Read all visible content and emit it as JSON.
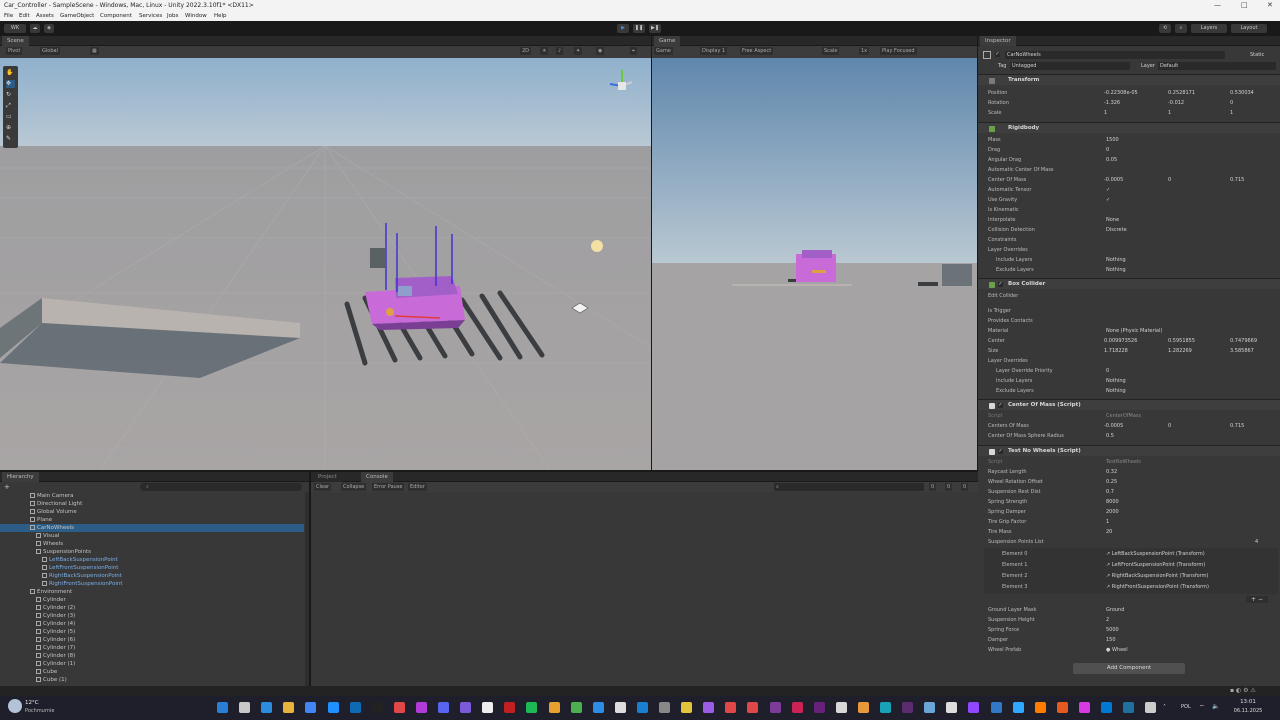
{
  "window": {
    "title": "Car_Controller - SampleScene - Windows, Mac, Linux - Unity 2022.3.10f1* <DX11>",
    "controls": [
      "—",
      "□",
      "✕"
    ]
  },
  "menu": [
    "File",
    "Edit",
    "Assets",
    "GameObject",
    "Component",
    "Services",
    "Jobs",
    "Window",
    "Help"
  ],
  "toolbar": {
    "account": "WK",
    "layers": "Layers",
    "layout": "Layout"
  },
  "scene": {
    "tab": "Scene",
    "pivot": "Pivot",
    "global": "Global",
    "mode_2d": "2D",
    "persp": "Persp"
  },
  "game": {
    "tab": "Game",
    "display_tab": "Game",
    "display": "Display 1",
    "aspect": "Free Aspect",
    "scale_label": "Scale",
    "scale": "1x",
    "play_focused": "Play Focused"
  },
  "inspector": {
    "tab": "Inspector",
    "object_name": "CarNoWheels",
    "static": "Static",
    "tag_label": "Tag",
    "tag": "Untagged",
    "layer_label": "Layer",
    "layer": "Default",
    "transform": {
      "name": "Transform",
      "position_label": "Position",
      "position": [
        "-0.22308e-05",
        "0.2528171",
        "0.530034"
      ],
      "rotation_label": "Rotation",
      "rotation": [
        "-1.326",
        "-0.012",
        "0"
      ],
      "scale_label": "Scale",
      "scale": [
        "1",
        "1",
        "1"
      ]
    },
    "rigidbody": {
      "name": "Rigidbody",
      "rows": [
        [
          "Mass",
          "1500"
        ],
        [
          "Drag",
          "0"
        ],
        [
          "Angular Drag",
          "0.05"
        ],
        [
          "Automatic Center Of Mass",
          ""
        ],
        [
          "Center Of Mass",
          ""
        ],
        [
          "Automatic Tensor",
          "✓"
        ],
        [
          "Use Gravity",
          "✓"
        ],
        [
          "Is Kinematic",
          ""
        ],
        [
          "Interpolate",
          "None"
        ],
        [
          "Collision Detection",
          "Discrete"
        ],
        [
          "Constraints",
          ""
        ],
        [
          "Layer Overrides",
          ""
        ],
        [
          "Include Layers",
          "Nothing"
        ],
        [
          "Exclude Layers",
          "Nothing"
        ]
      ],
      "com": [
        "-0.0005",
        "0",
        "0.715"
      ]
    },
    "box_collider": {
      "name": "Box Collider",
      "rows": [
        [
          "Edit Collider",
          ""
        ],
        [
          "Is Trigger",
          ""
        ],
        [
          "Provides Contacts",
          ""
        ],
        [
          "Material",
          "None (Physic Material)"
        ],
        [
          "Center",
          ""
        ],
        [
          "Size",
          ""
        ],
        [
          "Layer Overrides",
          ""
        ],
        [
          "Layer Override Priority",
          "0"
        ],
        [
          "Include Layers",
          "Nothing"
        ],
        [
          "Exclude Layers",
          "Nothing"
        ]
      ],
      "center": [
        "0.009973526",
        "0.5951855",
        "0.7479669"
      ],
      "size": [
        "1.718228",
        "1.282269",
        "3.585867"
      ]
    },
    "center_of_mass": {
      "name": "Center Of Mass (Script)",
      "script_label": "Script",
      "script": "CenterOfMass",
      "rows": [
        [
          "Centers Of Mass",
          ""
        ],
        [
          "Center Of Mass Sphere Radius",
          "0.5"
        ]
      ],
      "com": [
        "-0.0005",
        "0",
        "0.715"
      ]
    },
    "test_no_wheels": {
      "name": "Test No Wheels (Script)",
      "script_label": "Script",
      "script": "TestNoWheels",
      "rows": [
        [
          "Raycast Length",
          "0.32"
        ],
        [
          "Wheel Rotation Offset",
          "0.25"
        ],
        [
          "Suspension Rest Dist",
          "0.7"
        ],
        [
          "Spring Strength",
          "8000"
        ],
        [
          "Spring Damper",
          "2000"
        ],
        [
          "Tire Grip Factor",
          "1"
        ],
        [
          "Tire Mass",
          "20"
        ]
      ],
      "list_label": "Suspension Points List",
      "list_count": "4",
      "elements": [
        [
          "Element 0",
          "↗ LeftBackSuspensionPoint (Transform)"
        ],
        [
          "Element 1",
          "↗ LeftFrontSuspensionPoint (Transform)"
        ],
        [
          "Element 2",
          "↗ RightBackSuspensionPoint (Transform)"
        ],
        [
          "Element 3",
          "↗ RightFrontSuspensionPoint (Transform)"
        ]
      ],
      "rows2": [
        [
          "Ground Layer Mask",
          "Ground"
        ],
        [
          "Suspension Height",
          "2"
        ],
        [
          "Spring Force",
          "5000"
        ],
        [
          "Damper",
          "150"
        ],
        [
          "Wheel Prefab",
          "● Wheel"
        ]
      ]
    },
    "add_component": "Add Component"
  },
  "hierarchy": {
    "tab": "Hierarchy",
    "items": [
      {
        "label": "Main Camera",
        "indent": 0
      },
      {
        "label": "Directional Light",
        "indent": 0
      },
      {
        "label": "Global Volume",
        "indent": 0
      },
      {
        "label": "Plane",
        "indent": 0
      },
      {
        "label": "CarNoWheels",
        "indent": 0,
        "sel": true
      },
      {
        "label": "Visual",
        "indent": 1
      },
      {
        "label": "Wheels",
        "indent": 1
      },
      {
        "label": "SuspensionPoints",
        "indent": 1
      },
      {
        "label": "LeftBackSuspensionPoint",
        "indent": 2
      },
      {
        "label": "LeftFrontSuspensionPoint",
        "indent": 2
      },
      {
        "label": "RightBackSuspensionPoint",
        "indent": 2
      },
      {
        "label": "RightFrontSuspensionPoint",
        "indent": 2
      },
      {
        "label": "Environment",
        "indent": 0
      },
      {
        "label": "Cylinder",
        "indent": 1
      },
      {
        "label": "Cylinder (2)",
        "indent": 1
      },
      {
        "label": "Cylinder (3)",
        "indent": 1
      },
      {
        "label": "Cylinder (4)",
        "indent": 1
      },
      {
        "label": "Cylinder (5)",
        "indent": 1
      },
      {
        "label": "Cylinder (6)",
        "indent": 1
      },
      {
        "label": "Cylinder (7)",
        "indent": 1
      },
      {
        "label": "Cylinder (8)",
        "indent": 1
      },
      {
        "label": "Cylinder (1)",
        "indent": 1
      },
      {
        "label": "Cube",
        "indent": 1
      },
      {
        "label": "Cube (1)",
        "indent": 1
      }
    ]
  },
  "console": {
    "project_tab": "Project",
    "console_tab": "Console",
    "clear": "Clear",
    "collapse": "Collapse",
    "error_pause": "Error Pause",
    "editor": "Editor",
    "counts": [
      "0",
      "0",
      "0"
    ]
  },
  "taskbar": {
    "weather_temp": "12°C",
    "weather_desc": "Pochmurnie",
    "lang": "POL",
    "time": "13:01",
    "date": "06.11.2025"
  }
}
